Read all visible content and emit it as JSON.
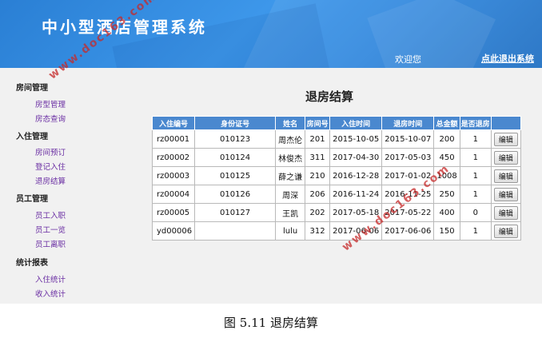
{
  "header": {
    "title": "中小型酒店管理系统",
    "welcome": "欢迎您",
    "logout": "点此退出系统"
  },
  "sidebar": {
    "groups": [
      {
        "title": "房间管理",
        "items": [
          "房型管理",
          "房态查询"
        ]
      },
      {
        "title": "入住管理",
        "items": [
          "房间预订",
          "登记入住",
          "退房结算"
        ]
      },
      {
        "title": "员工管理",
        "items": [
          "员工入职",
          "员工一览",
          "员工离职"
        ]
      },
      {
        "title": "统计报表",
        "items": [
          "入住统计",
          "收入统计"
        ]
      }
    ]
  },
  "main": {
    "page_title": "退房结算",
    "columns": [
      "入住编号",
      "身份证号",
      "姓名",
      "房间号",
      "入住时间",
      "退房时间",
      "总金额",
      "是否退房",
      ""
    ],
    "rows": [
      [
        "rz00001",
        "010123",
        "周杰伦",
        "201",
        "2015-10-05",
        "2015-10-07",
        "200",
        "1"
      ],
      [
        "rz00002",
        "010124",
        "林俊杰",
        "311",
        "2017-04-30",
        "2017-05-03",
        "450",
        "1"
      ],
      [
        "rz00003",
        "010125",
        "薛之谦",
        "210",
        "2016-12-28",
        "2017-01-02",
        "1008",
        "1"
      ],
      [
        "rz00004",
        "010126",
        "周深",
        "206",
        "2016-11-24",
        "2016-11-25",
        "250",
        "1"
      ],
      [
        "rz00005",
        "010127",
        "王凯",
        "202",
        "2017-05-18",
        "2017-05-22",
        "400",
        "0"
      ],
      [
        "yd00006",
        "",
        "lulu",
        "312",
        "2017-06-06",
        "2017-06-06",
        "150",
        "1"
      ]
    ],
    "edit_label": "编辑"
  },
  "watermark": "www.doc163.com",
  "caption": "图 5.11  退房结算"
}
